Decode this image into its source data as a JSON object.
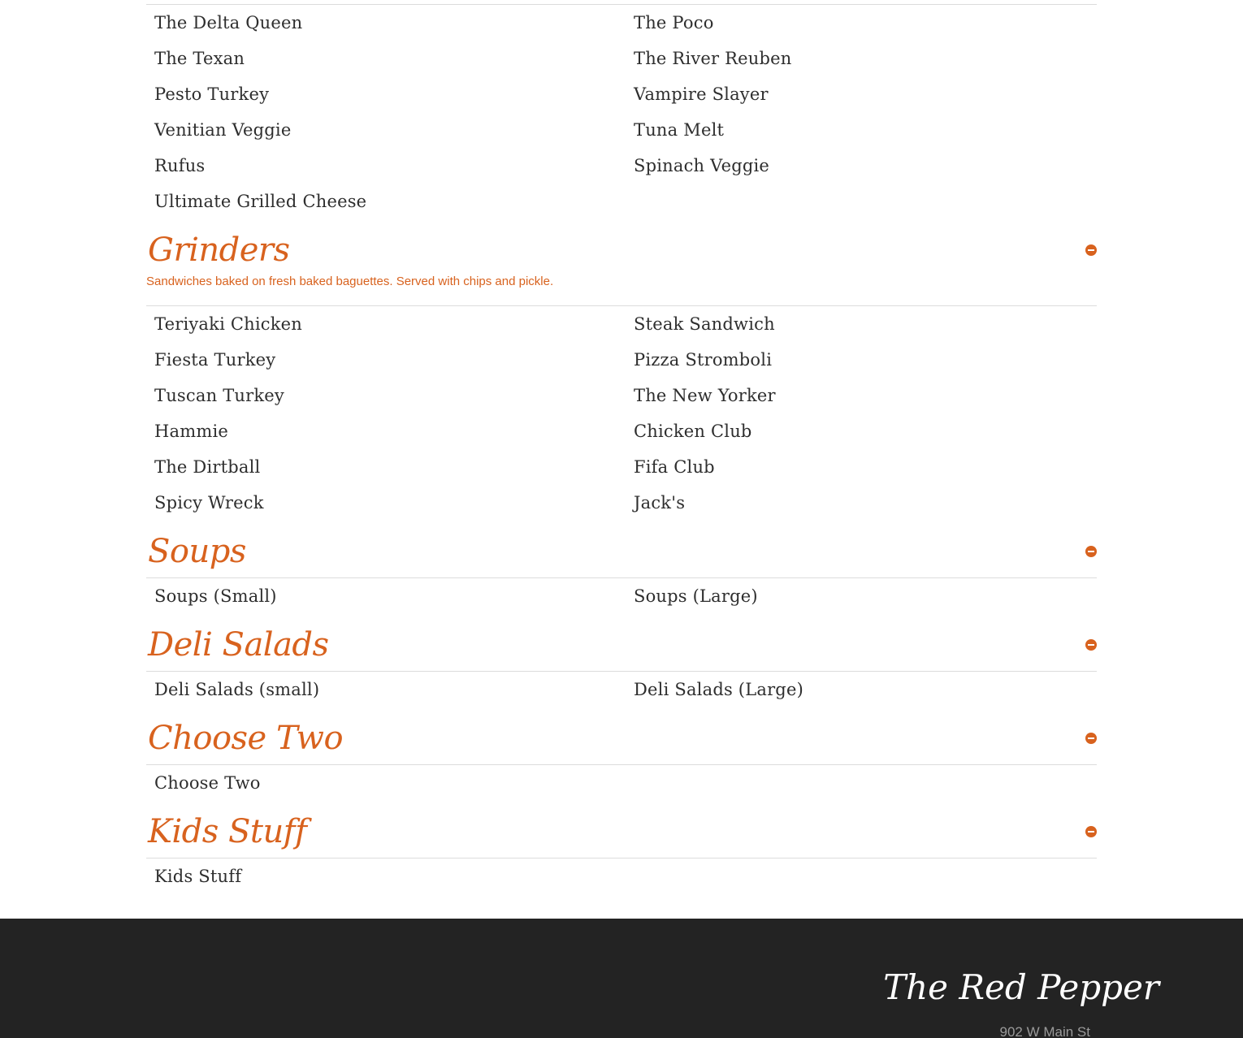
{
  "menu": {
    "sandwiches_continued": {
      "items": [
        "The Delta Queen",
        "The Poco",
        "The Texan",
        "The River Reuben",
        "Pesto Turkey",
        "Vampire Slayer",
        "Venitian Veggie",
        "Tuna Melt",
        "Rufus",
        "Spinach Veggie",
        "Ultimate Grilled Cheese"
      ]
    },
    "grinders": {
      "title": "Grinders",
      "description": "Sandwiches baked on fresh baked baguettes. Served with chips and pickle.",
      "items": [
        "Teriyaki Chicken",
        "Steak Sandwich",
        "Fiesta Turkey",
        "Pizza Stromboli",
        "Tuscan Turkey",
        "The New Yorker",
        "Hammie",
        "Chicken Club",
        "The Dirtball",
        "Fifa Club",
        "Spicy Wreck",
        "Jack's"
      ]
    },
    "soups": {
      "title": "Soups",
      "items": [
        "Soups (Small)",
        "Soups (Large)"
      ]
    },
    "deli_salads": {
      "title": "Deli Salads",
      "items": [
        "Deli Salads (small)",
        "Deli Salads (Large)"
      ]
    },
    "choose_two": {
      "title": "Choose Two",
      "items": [
        "Choose Two"
      ]
    },
    "kids_stuff": {
      "title": "Kids Stuff",
      "items": [
        "Kids Stuff"
      ]
    }
  },
  "footer": {
    "brand": "The Red Pepper",
    "address": "902 W Main St"
  },
  "colors": {
    "accent": "#d8621e",
    "footer_background": "#232323",
    "item_text": "#2e2e2e"
  },
  "icons": {
    "section_toggle": "collapse-minus-icon"
  }
}
